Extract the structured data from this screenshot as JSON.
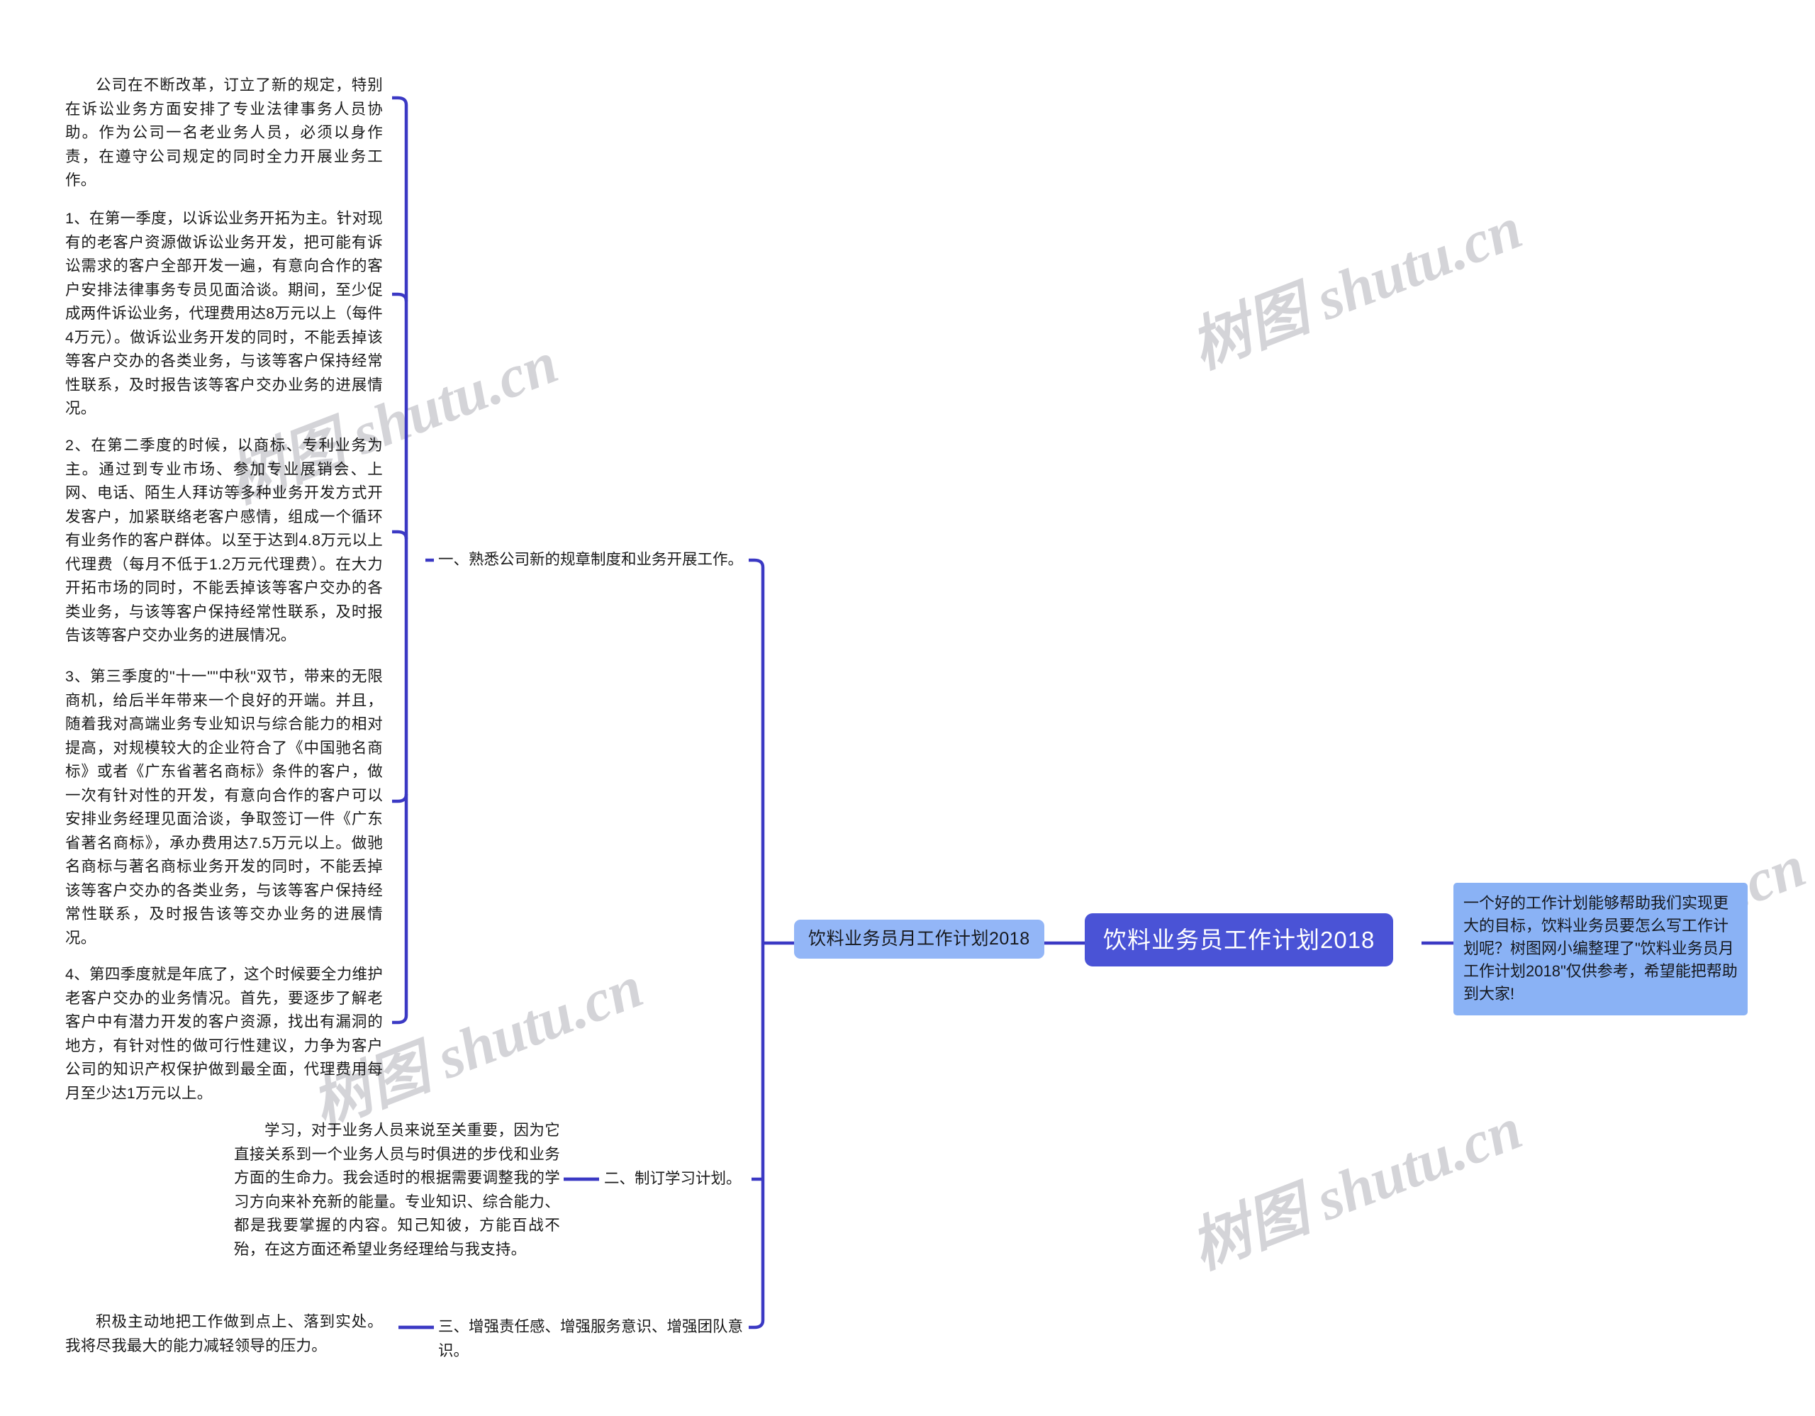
{
  "theme": {
    "line_color": "#3b39c4",
    "root_bg": "#4a53d6",
    "sub_bg": "#93b6f7",
    "note_bg": "#8ab2f5",
    "text_color": "#1a1a1a",
    "watermark_color": "#d4d4d8",
    "canvas_bg": "#ffffff"
  },
  "root": {
    "label": "饮料业务员工作计划2018"
  },
  "subtopic": {
    "label": "饮料业务员月工作计划2018"
  },
  "note": {
    "text": "一个好的工作计划能够帮助我们实现更大的目标，饮料业务员要怎么写工作计划呢？树图网小编整理了\"饮料业务员月工作计划2018\"仅供参考，希望能把帮助到大家!"
  },
  "branches": [
    {
      "label": "一、熟悉公司新的规章制度和业务开展工作。"
    },
    {
      "label": "二、制订学习计划。"
    },
    {
      "label": "三、增强责任感、增强服务意识、增强团队意识。"
    }
  ],
  "leaves": [
    {
      "id": "leaf-company-reform",
      "text": "公司在不断改革，订立了新的规定，特别在诉讼业务方面安排了专业法律事务人员协助。作为公司一名老业务人员，必须以身作责，在遵守公司规定的同时全力开展业务工作。"
    },
    {
      "id": "leaf-q1",
      "text": "1、在第一季度，以诉讼业务开拓为主。针对现有的老客户资源做诉讼业务开发，把可能有诉讼需求的客户全部开发一遍，有意向合作的客户安排法律事务专员见面洽谈。期间，至少促成两件诉讼业务，代理费用达8万元以上（每件4万元）。做诉讼业务开发的同时，不能丢掉该等客户交办的各类业务，与该等客户保持经常性联系，及时报告该等客户交办业务的进展情况。"
    },
    {
      "id": "leaf-q2",
      "text": "2、在第二季度的时候，以商标、专利业务为主。通过到专业市场、参加专业展销会、上网、电话、陌生人拜访等多种业务开发方式开发客户，加紧联络老客户感情，组成一个循环有业务作的客户群体。以至于达到4.8万元以上代理费（每月不低于1.2万元代理费）。在大力开拓市场的同时，不能丢掉该等客户交办的各类业务，与该等客户保持经常性联系，及时报告该等客户交办业务的进展情况。"
    },
    {
      "id": "leaf-q3",
      "text": "3、第三季度的\"十一\"\"中秋\"双节，带来的无限商机，给后半年带来一个良好的开端。并且，随着我对高端业务专业知识与综合能力的相对提高，对规模较大的企业符合了《中国驰名商标》或者《广东省著名商标》条件的客户，做一次有针对性的开发，有意向合作的客户可以安排业务经理见面洽谈，争取签订一件《广东省著名商标》，承办费用达7.5万元以上。做驰名商标与著名商标业务开发的同时，不能丢掉该等客户交办的各类业务，与该等客户保持经常性联系，及时报告该等交办业务的进展情况。"
    },
    {
      "id": "leaf-q4",
      "text": "4、第四季度就是年底了，这个时候要全力维护老客户交办的业务情况。首先，要逐步了解老客户中有潜力开发的客户资源，找出有漏洞的地方，有针对性的做可行性建议，力争为客户公司的知识产权保护做到最全面，代理费用每月至少达1万元以上。"
    },
    {
      "id": "leaf-study",
      "text": "学习，对于业务人员来说至关重要，因为它直接关系到一个业务人员与时俱进的步伐和业务方面的生命力。我会适时的根据需要调整我的学习方向来补充新的能量。专业知识、综合能力、都是我要掌握的内容。知己知彼，方能百战不殆，在这方面还希望业务经理给与我支持。"
    },
    {
      "id": "leaf-responsibility",
      "text": "积极主动地把工作做到点上、落到实处。我将尽我最大的能力减轻领导的压力。"
    }
  ],
  "watermarks": [
    {
      "text": "树图 shutu.cn"
    },
    {
      "text": "树图 shutu.cn"
    },
    {
      "text": "树图 shutu.cn"
    },
    {
      "text": "树图 shutu.cn"
    },
    {
      "text": "树图 shutu.cn"
    }
  ]
}
